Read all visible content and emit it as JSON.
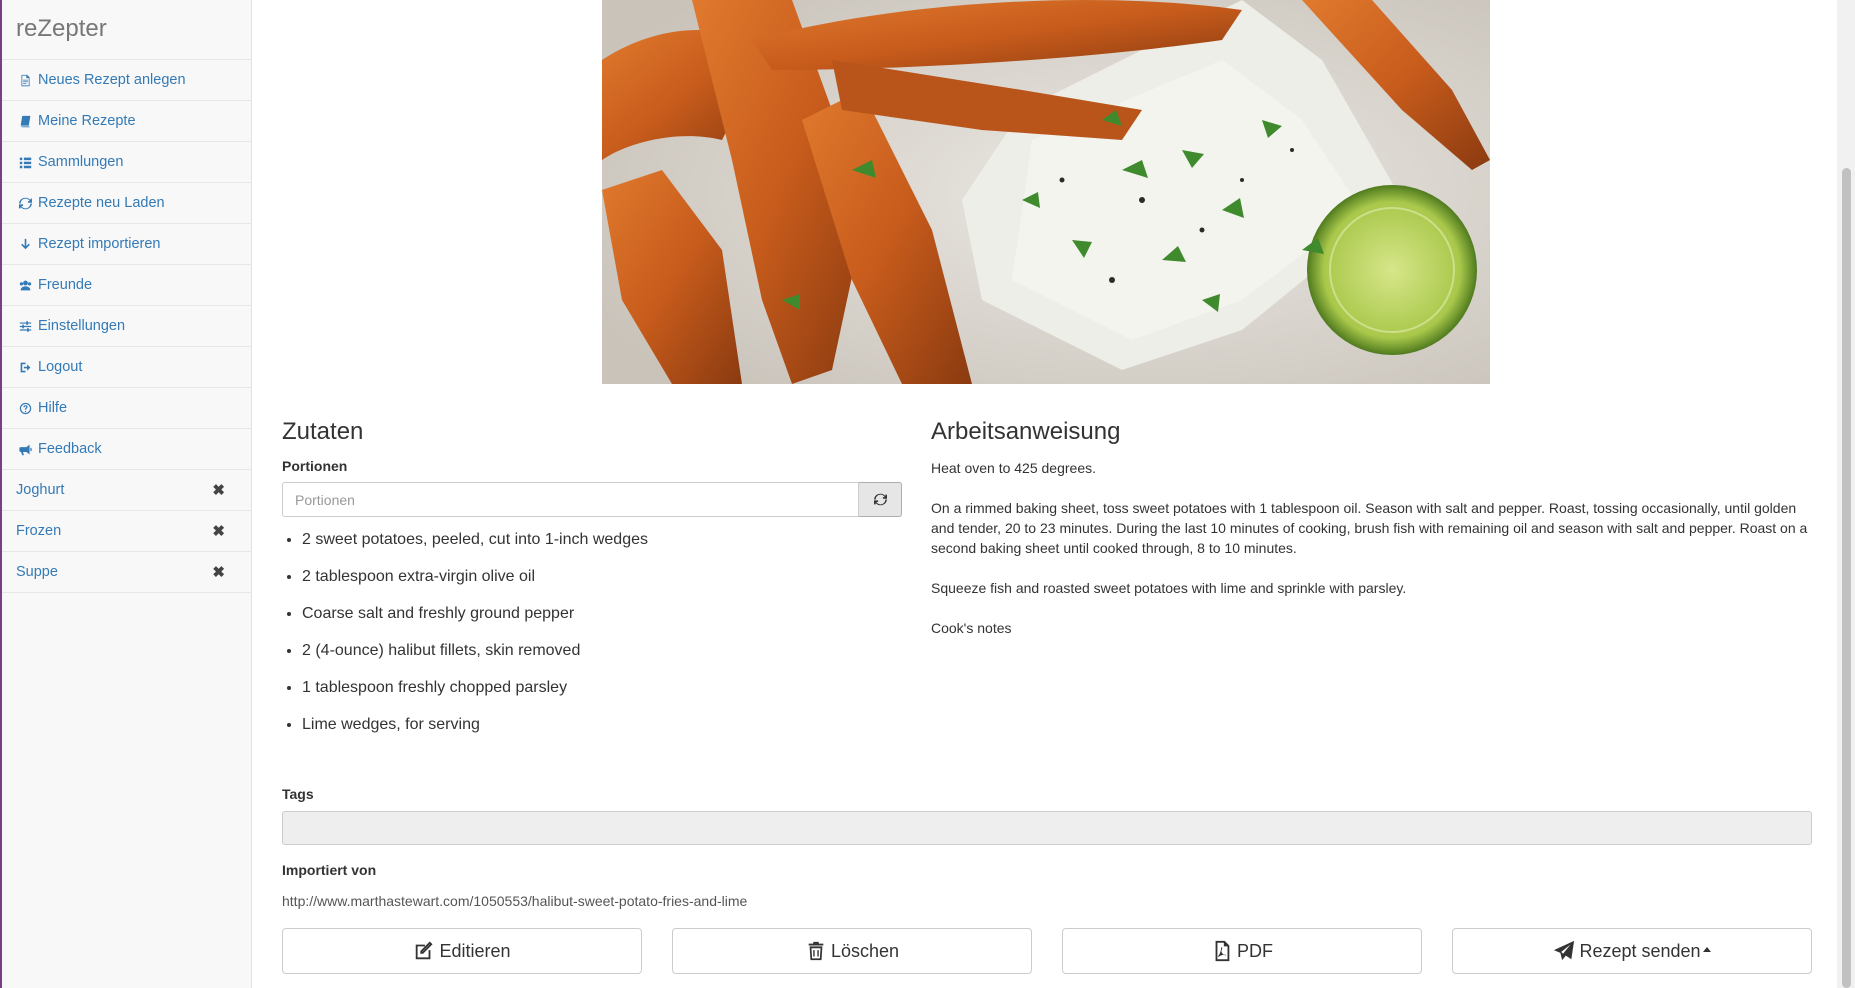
{
  "app": {
    "brand": "reZepter"
  },
  "sidebar": {
    "items": [
      {
        "label": "Neues Rezept anlegen",
        "icon": "file-icon"
      },
      {
        "label": "Meine Rezepte",
        "icon": "book-icon"
      },
      {
        "label": "Sammlungen",
        "icon": "list-icon"
      },
      {
        "label": "Rezepte neu Laden",
        "icon": "refresh-icon"
      },
      {
        "label": "Rezept importieren",
        "icon": "arrow-down-icon"
      },
      {
        "label": "Freunde",
        "icon": "users-icon"
      },
      {
        "label": "Einstellungen",
        "icon": "sliders-icon"
      },
      {
        "label": "Logout",
        "icon": "sign-out-icon"
      },
      {
        "label": "Hilfe",
        "icon": "question-circle-icon"
      },
      {
        "label": "Feedback",
        "icon": "bullhorn-icon"
      }
    ],
    "collections": [
      {
        "label": "Joghurt"
      },
      {
        "label": "Frozen"
      },
      {
        "label": "Suppe"
      }
    ]
  },
  "recipe": {
    "ingredients_title": "Zutaten",
    "portions_label": "Portionen",
    "portions_placeholder": "Portionen",
    "ingredients": [
      "2 sweet potatoes, peeled, cut into 1-inch wedges",
      "2 tablespoon extra-virgin olive oil",
      "Coarse salt and freshly ground pepper",
      "2 (4-ounce) halibut fillets, skin removed",
      "1 tablespoon freshly chopped parsley",
      "Lime wedges, for serving"
    ],
    "instructions_title": "Arbeitsanweisung",
    "instructions": [
      "Heat oven to 425 degrees.",
      "On a rimmed baking sheet, toss sweet potatoes with 1 tablespoon oil. Season with salt and pepper. Roast, tossing occasionally, until golden and tender, 20 to 23 minutes. During the last 10 minutes of cooking, brush fish with remaining oil and season with salt and pepper. Roast on a second baking sheet until cooked through, 8 to 10 minutes.",
      "Squeeze fish and roasted sweet potatoes with lime and sprinkle with parsley.",
      "Cook's notes"
    ],
    "tags_label": "Tags",
    "tags_value": "",
    "imported_label": "Importiert von",
    "imported_url": "http://www.marthastewart.com/1050553/halibut-sweet-potato-fries-and-lime"
  },
  "actions": {
    "edit": "Editieren",
    "delete": "Löschen",
    "pdf": "PDF",
    "send": "Rezept senden"
  },
  "colors": {
    "link": "#337ab7",
    "sidebar_bg": "#f8f8f8",
    "edge": "#7a3d86"
  }
}
